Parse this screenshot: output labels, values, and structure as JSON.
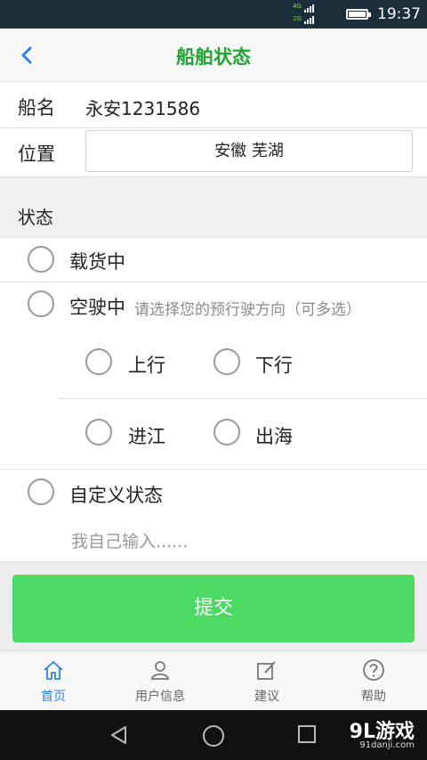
{
  "status_bar": {
    "network_top": "4G",
    "network_bottom": "2G",
    "time": "19:37"
  },
  "header": {
    "title": "船舶状态",
    "back_icon": "chevron-left-icon"
  },
  "ship": {
    "name_label": "船名",
    "name_value": "永安1231586",
    "location_label": "位置",
    "location_value": "安徽 芜湖"
  },
  "status": {
    "section_label": "状态",
    "loaded_label": "载货中",
    "empty_label": "空驶中",
    "empty_hint": "请选择您的预行驶方向（可多选）",
    "directions": [
      "上行",
      "下行",
      "进江",
      "出海"
    ],
    "custom_label": "自定义状态",
    "custom_placeholder": "我自己输入......"
  },
  "submit_label": "提交",
  "tabs": [
    {
      "label": "首页",
      "icon": "home-icon",
      "active": true
    },
    {
      "label": "用户信息",
      "icon": "user-icon",
      "active": false
    },
    {
      "label": "建议",
      "icon": "edit-icon",
      "active": false
    },
    {
      "label": "帮助",
      "icon": "help-icon",
      "active": false
    }
  ],
  "watermark": {
    "logo": "9L游戏",
    "domain": "91danji.com"
  },
  "colors": {
    "accent_green": "#23a336",
    "button_green": "#4cd964",
    "active_tab_blue": "#2f80e8"
  }
}
